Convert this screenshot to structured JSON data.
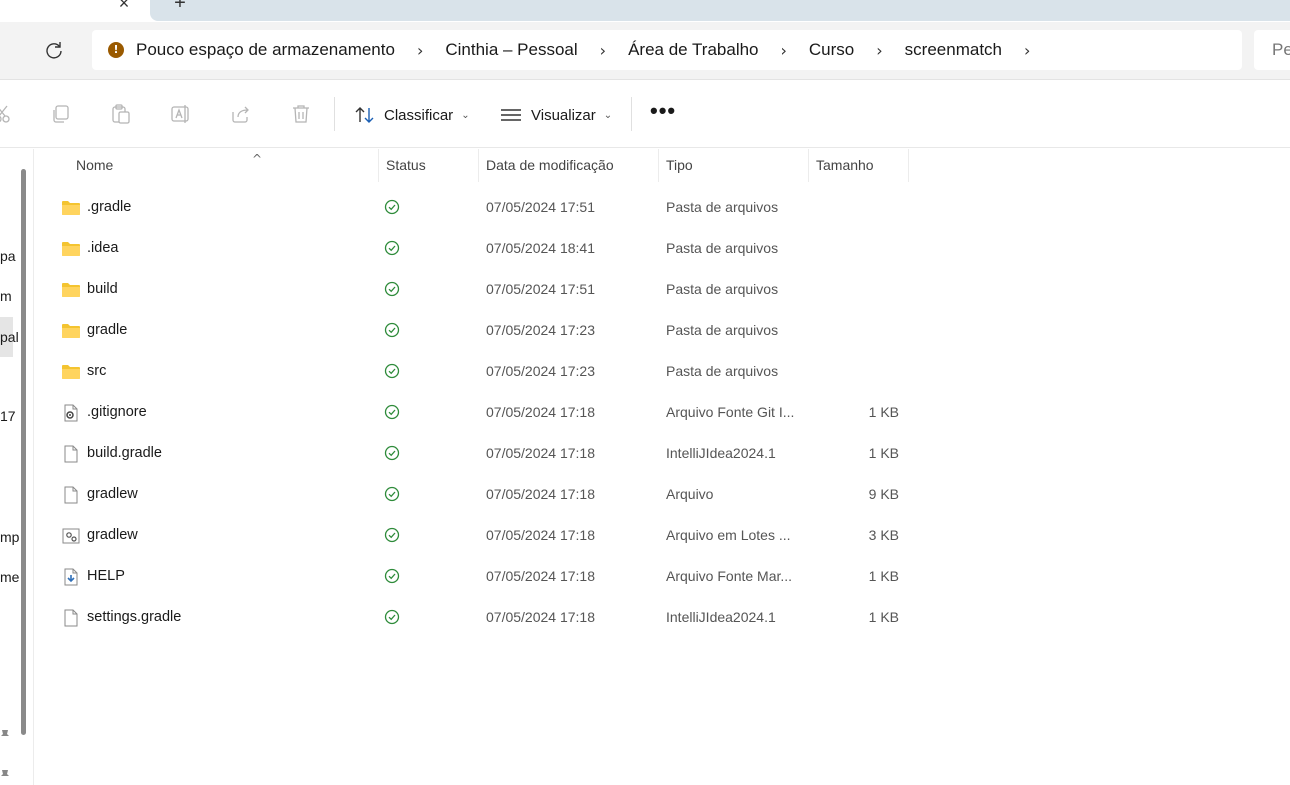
{
  "tabs": {
    "close_glyph": "×",
    "new_tab_glyph": "+"
  },
  "address": {
    "warning_glyph": "!",
    "crumbs": [
      "Pouco espaço de armazenamento",
      "Cinthia – Pessoal",
      "Área de Trabalho",
      "Curso",
      "screenmatch"
    ],
    "separator": "›",
    "search_placeholder": "Pe"
  },
  "toolbar": {
    "icons": [
      "cut-icon",
      "copy-icon",
      "paste-icon",
      "rename-icon",
      "share-icon",
      "delete-icon"
    ],
    "sort_label": "Classificar",
    "view_label": "Visualizar",
    "dropdown_glyph": "⌄",
    "more_glyph": "•••"
  },
  "navpane": {
    "fragments": [
      "pa",
      "m",
      "pal",
      "17",
      "mp",
      "me"
    ]
  },
  "columns": {
    "name": "Nome",
    "status": "Status",
    "date": "Data de modificação",
    "type": "Tipo",
    "size": "Tamanho",
    "sort_glyph": "^"
  },
  "files": [
    {
      "name": ".gradle",
      "icon": "folder-icon",
      "date": "07/05/2024 17:51",
      "type": "Pasta de arquivos",
      "size": ""
    },
    {
      "name": ".idea",
      "icon": "folder-icon",
      "date": "07/05/2024 18:41",
      "type": "Pasta de arquivos",
      "size": ""
    },
    {
      "name": "build",
      "icon": "folder-icon",
      "date": "07/05/2024 17:51",
      "type": "Pasta de arquivos",
      "size": ""
    },
    {
      "name": "gradle",
      "icon": "folder-icon",
      "date": "07/05/2024 17:23",
      "type": "Pasta de arquivos",
      "size": ""
    },
    {
      "name": "src",
      "icon": "folder-icon",
      "date": "07/05/2024 17:23",
      "type": "Pasta de arquivos",
      "size": ""
    },
    {
      "name": ".gitignore",
      "icon": "config-file-icon",
      "date": "07/05/2024 17:18",
      "type": "Arquivo Fonte Git I...",
      "size": "1 KB"
    },
    {
      "name": "build.gradle",
      "icon": "file-icon",
      "date": "07/05/2024 17:18",
      "type": "IntelliJIdea2024.1",
      "size": "1 KB"
    },
    {
      "name": "gradlew",
      "icon": "file-icon",
      "date": "07/05/2024 17:18",
      "type": "Arquivo",
      "size": "9 KB"
    },
    {
      "name": "gradlew",
      "icon": "batch-file-icon",
      "date": "07/05/2024 17:18",
      "type": "Arquivo em Lotes ...",
      "size": "3 KB"
    },
    {
      "name": "HELP",
      "icon": "markdown-file-icon",
      "date": "07/05/2024 17:18",
      "type": "Arquivo Fonte Mar...",
      "size": "1 KB"
    },
    {
      "name": "settings.gradle",
      "icon": "file-icon",
      "date": "07/05/2024 17:18",
      "type": "IntelliJIdea2024.1",
      "size": "1 KB"
    }
  ],
  "colors": {
    "folder": "#f4c430",
    "status_ok": "#2e8b3a",
    "warning": "#9a5a00",
    "address_bg": "#f3f3f3"
  }
}
